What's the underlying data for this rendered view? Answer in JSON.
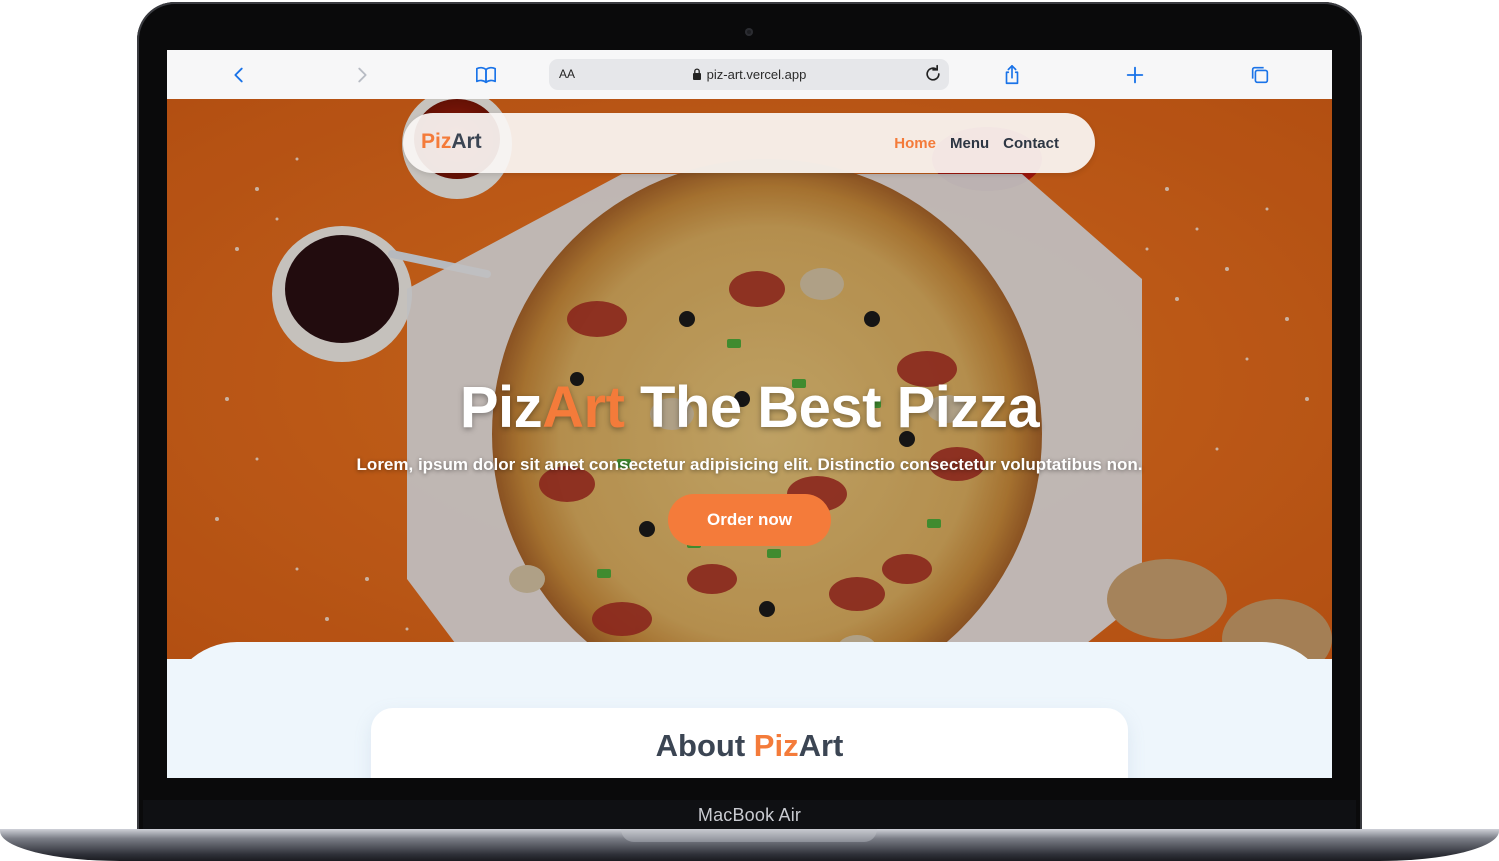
{
  "device": {
    "brand_label": "MacBook Air"
  },
  "browser": {
    "text_size_label": "AA",
    "url": "piz-art.vercel.app",
    "icons": [
      "back-icon",
      "forward-icon",
      "bookmarks-icon",
      "lock-icon",
      "reload-icon",
      "share-icon",
      "new-tab-icon",
      "tabs-icon"
    ]
  },
  "site": {
    "logo_part1": "Piz",
    "logo_part2": "Art",
    "nav": {
      "home": "Home",
      "menu": "Menu",
      "contact": "Contact"
    },
    "hero": {
      "title_part1": "Piz",
      "title_part2": "Art",
      "title_part3": " The Best Pizza",
      "subtitle": "Lorem, ipsum dolor sit amet consectetur adipisicing elit. Distinctio consectetur voluptatibus non.",
      "cta": "Order now"
    },
    "about": {
      "title_part1": "About ",
      "title_part2": "Piz",
      "title_part3": "Art"
    }
  },
  "colors": {
    "accent": "#f47b3a",
    "heading": "#3b4553",
    "hero_background": "#e76a1c",
    "section_background": "#eef6fc",
    "browser_link": "#1a73e8"
  }
}
